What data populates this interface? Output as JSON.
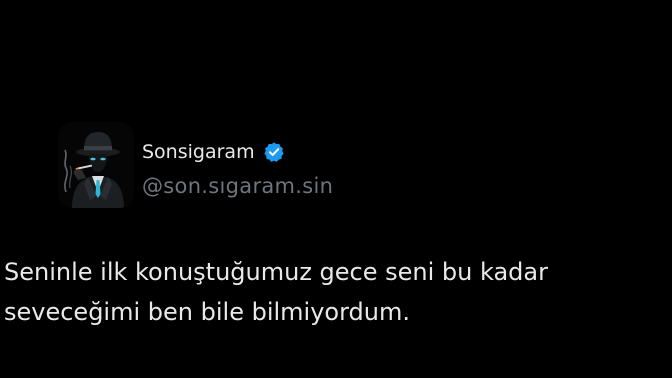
{
  "tweet": {
    "author": {
      "display_name": "Sonsigaram",
      "handle": "@son.sıgaram.sin",
      "verified": true,
      "avatar_icon": "man-in-fedora-smoking-avatar"
    },
    "text_lines": [
      "Seninle ilk konuştuğumuz gece seni bu kadar",
      "seveceğimi ben bile bilmiyordum."
    ]
  },
  "colors": {
    "background": "#000000",
    "primary_text": "#e7e9ea",
    "secondary_text": "#6e767d",
    "verified_badge": "#1d9bf0"
  }
}
